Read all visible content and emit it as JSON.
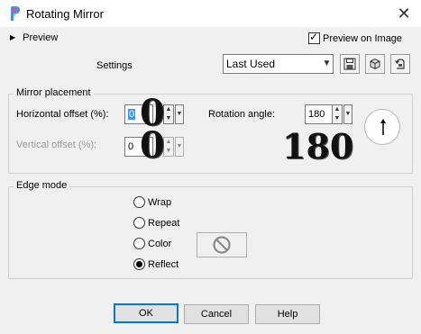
{
  "window": {
    "title": "Rotating Mirror",
    "close_glyph": "✕"
  },
  "preview": {
    "toggle_label": "Preview",
    "preview_on_image_label": "Preview on Image",
    "preview_on_image_checked": true
  },
  "settings": {
    "label": "Settings",
    "preset_value": "Last Used"
  },
  "mirror_placement": {
    "legend": "Mirror placement",
    "horizontal_offset_label": "Horizontal offset (%):",
    "horizontal_offset_value": "0",
    "horizontal_offset_overlay": "0",
    "vertical_offset_label": "Vertical offset (%):",
    "vertical_offset_value": "0",
    "vertical_offset_overlay": "0",
    "rotation_angle_label": "Rotation angle:",
    "rotation_angle_value": "180",
    "rotation_angle_overlay": "180"
  },
  "edge_mode": {
    "legend": "Edge mode",
    "options": [
      "Wrap",
      "Repeat",
      "Color",
      "Reflect"
    ],
    "selected": "Reflect"
  },
  "buttons": {
    "ok": "OK",
    "cancel": "Cancel",
    "help": "Help"
  },
  "icons": {
    "app": "psp-app-icon",
    "save": "save-icon",
    "delete": "delete-icon",
    "reset": "reset-icon",
    "no_color": "no-color-icon",
    "dial": "angle-dial-icon"
  },
  "colors": {
    "selection": "#3399ff",
    "ok_border": "#0078d7",
    "dialog_bg": "#f0f0f0"
  }
}
